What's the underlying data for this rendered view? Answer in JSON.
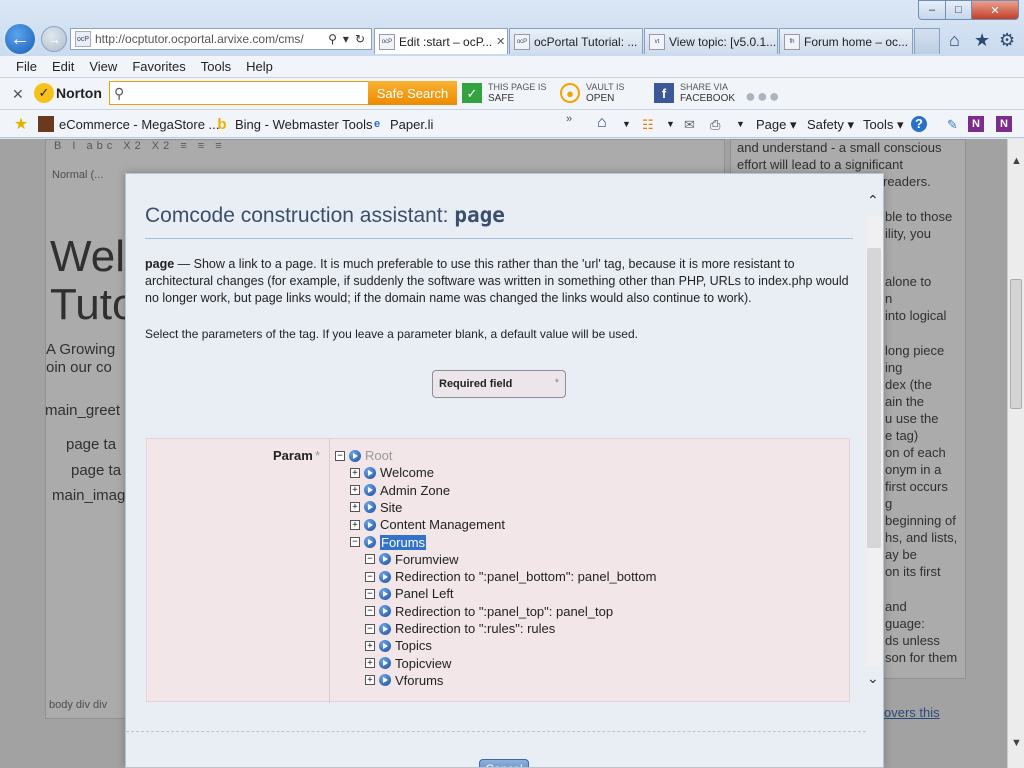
{
  "browser": {
    "url": "http://ocptutor.ocportal.arvixe.com/cms/",
    "tabs": [
      {
        "label": "Edit :start – ocP...",
        "fav": "ocP"
      },
      {
        "label": "ocPortal Tutorial: ...",
        "fav": "ocP"
      },
      {
        "label": "View topic: [v5.0.1...",
        "fav": "vt"
      },
      {
        "label": "Forum home – oc...",
        "fav": "fh"
      }
    ],
    "window_buttons": {
      "min": "–",
      "max": "□",
      "close": "✕"
    }
  },
  "menu": [
    "File",
    "Edit",
    "View",
    "Favorites",
    "Tools",
    "Help"
  ],
  "norton": {
    "logo": "Norton",
    "search_btn": "Safe Search",
    "status": [
      {
        "label": "THIS PAGE IS",
        "value": "SAFE"
      },
      {
        "label": "VAULT IS",
        "value": "OPEN"
      },
      {
        "label": "SHARE VIA",
        "value": "FACEBOOK"
      }
    ]
  },
  "favorites": {
    "links": [
      "eCommerce - MegaStore ...",
      "Bing - Webmaster Tools",
      "Paper.li"
    ],
    "commands": [
      "Page ▾",
      "Safety ▾",
      "Tools ▾"
    ]
  },
  "background_page": {
    "editor_lines": [
      "Normal (...",
      "Wel",
      "Tuto",
      "A Growing",
      "oin our co",
      "main_greet",
      "page ta",
      "page ta",
      "main_imag",
      "body  div  div"
    ],
    "side_lines": [
      "and understand - a small conscious",
      "effort will lead to a significant",
      "readers.",
      "ble to those",
      "ility, you",
      "alone to",
      "n",
      "into logical",
      "long piece",
      "ing",
      "dex (the",
      "ain the",
      "u use the",
      "e tag)",
      "on of each",
      "onym in a",
      "first occurs",
      "g",
      "beginning of",
      "hs, and lists,",
      "ay be",
      "on its first",
      "and",
      "guage:",
      "ds unless",
      "son for them",
      "overs this"
    ]
  },
  "modal": {
    "title_prefix": "Comcode construction assistant: ",
    "title_tag": "page",
    "desc_tag": "page",
    "desc_text": " — Show a link to a page. It is much preferable to use this rather than the 'url' tag, because it is more resistant to architectural changes (for example, if suddenly the software was written in something other than PHP, URLs to index.php would no longer work, but page links would; if the domain name was changed the links would also continue to work).",
    "instructions": "Select the parameters of the tag. If you leave a parameter blank, a default value will be used.",
    "required_label": "Required field",
    "required_star": "*",
    "param_label": "Param",
    "param_star": "*",
    "tree": [
      {
        "label": "Root",
        "level": 0,
        "expander": "minus",
        "state": "muted"
      },
      {
        "label": "Welcome",
        "level": 1,
        "expander": "plus"
      },
      {
        "label": "Admin Zone",
        "level": 1,
        "expander": "plus"
      },
      {
        "label": "Site",
        "level": 1,
        "expander": "plus"
      },
      {
        "label": "Content Management",
        "level": 1,
        "expander": "plus"
      },
      {
        "label": "Forums",
        "level": 1,
        "expander": "minus",
        "state": "selected"
      },
      {
        "label": "Forumview",
        "level": 2,
        "expander": "minus"
      },
      {
        "label": "Redirection to \":panel_bottom\": panel_bottom",
        "level": 2,
        "expander": "minus"
      },
      {
        "label": "Panel Left",
        "level": 2,
        "expander": "minus"
      },
      {
        "label": "Redirection to \":panel_top\": panel_top",
        "level": 2,
        "expander": "minus"
      },
      {
        "label": "Redirection to \":rules\": rules",
        "level": 2,
        "expander": "minus"
      },
      {
        "label": "Topics",
        "level": 2,
        "expander": "plus"
      },
      {
        "label": "Topicview",
        "level": 2,
        "expander": "plus"
      },
      {
        "label": "Vforums",
        "level": 2,
        "expander": "plus"
      }
    ],
    "cancel_label": "Cancel"
  }
}
